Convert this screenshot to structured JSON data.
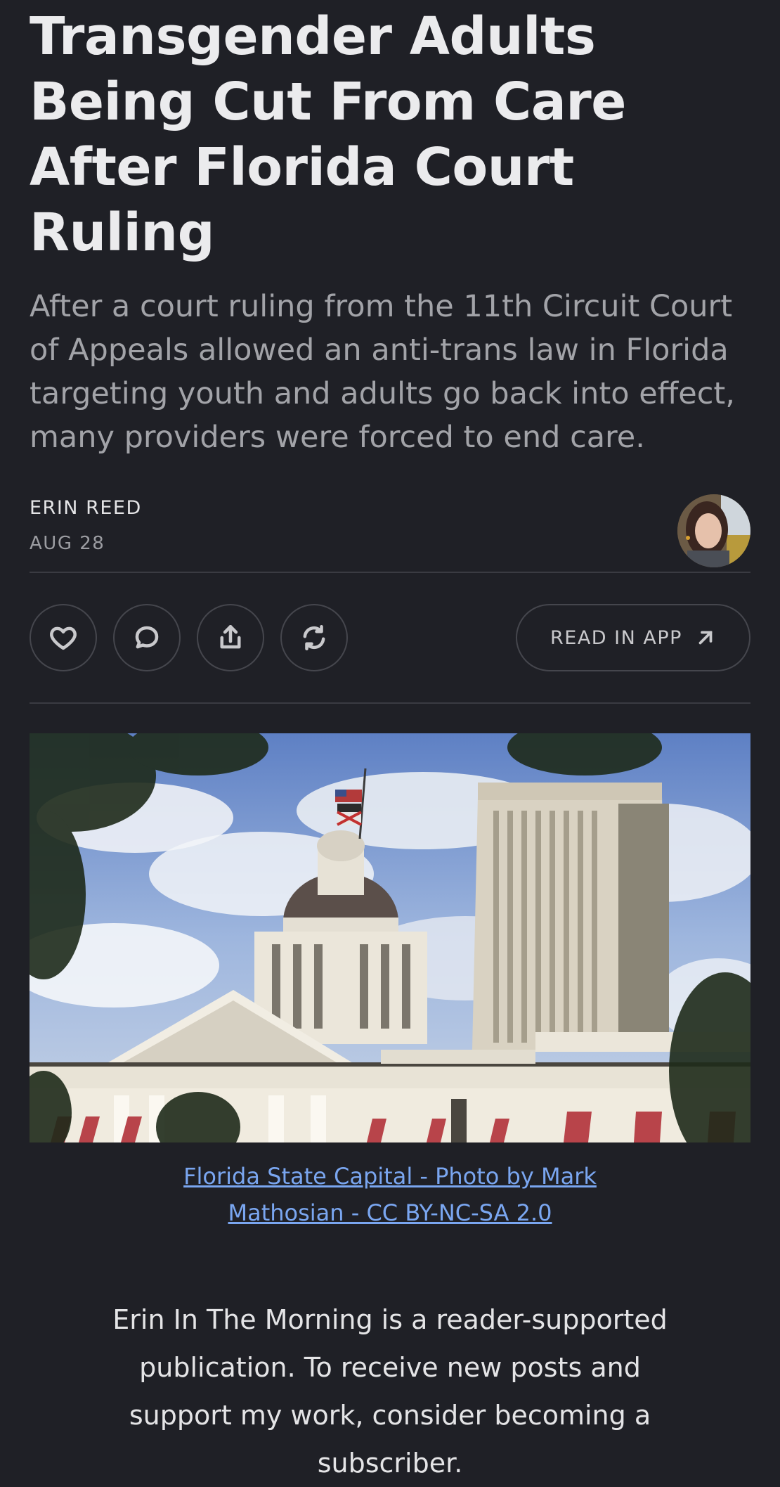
{
  "article": {
    "title": "Transgender Adults Being Cut From Care After Florida Court Ruling",
    "subtitle": "After a court ruling from the 11th Circuit Court of Appeals allowed an anti-trans law in Florida targeting youth and adults go back into effect, many providers were forced to end care.",
    "author": "ERIN REED",
    "date": "AUG 28"
  },
  "actions": {
    "like_icon": "heart-icon",
    "comment_icon": "comment-icon",
    "share_icon": "share-icon",
    "restack_icon": "restack-icon",
    "read_in_app_label": "READ IN APP",
    "read_in_app_icon": "arrow-up-right-icon"
  },
  "hero": {
    "caption": "Florida State Capital - Photo by Mark Mathosian - CC BY-NC-SA 2.0"
  },
  "support": {
    "text": "Erin In The Morning is a reader-supported publication. To receive new posts and support my work, consider becoming a subscriber."
  }
}
